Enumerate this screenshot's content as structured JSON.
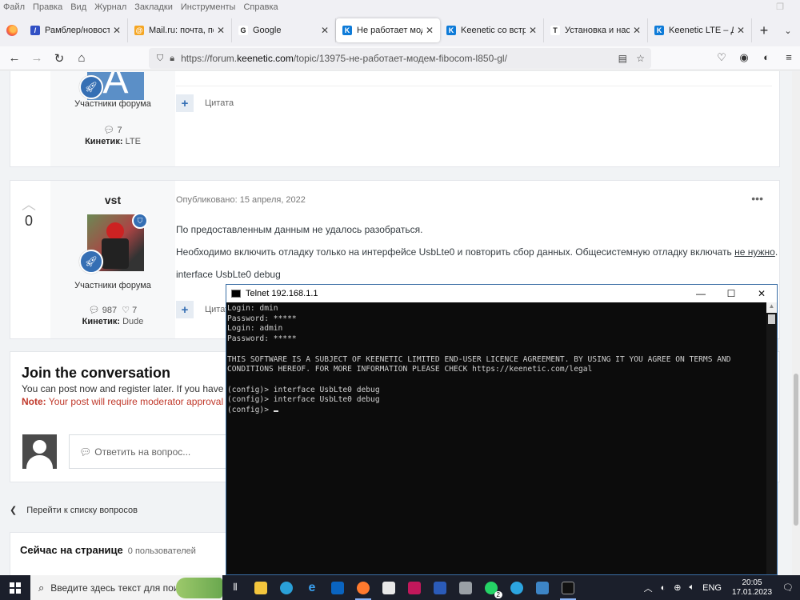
{
  "menu": [
    "Файл",
    "Правка",
    "Вид",
    "Журнал",
    "Закладки",
    "Инструменты",
    "Справка"
  ],
  "tabs": [
    {
      "title": "Рамблер/новости, почта",
      "color": "#3150c4",
      "glyph": "/"
    },
    {
      "title": "Mail.ru: почта, поиск",
      "color": "#f5a623",
      "glyph": "@"
    },
    {
      "title": "Google",
      "color": "#ffffff",
      "glyph": "G"
    },
    {
      "title": "Не работает модем Fibocom",
      "color": "#0e7bd8",
      "glyph": "K"
    },
    {
      "title": "Keenetic со встроенным",
      "color": "#0e7bd8",
      "glyph": "K"
    },
    {
      "title": "Установка и настройка",
      "color": "#ffffff",
      "glyph": "T"
    },
    {
      "title": "Keenetic LTE – Диагностика",
      "color": "#0e7bd8",
      "glyph": "K"
    }
  ],
  "url": {
    "prefix": "https://forum.",
    "domain": "keenetic.com",
    "path": "/topic/13975-не-работает-модем-fibocom-l850-gl/"
  },
  "post1": {
    "avatar_letter": "A",
    "role": "Участники форума",
    "posts": "7",
    "kinetic_label": "Кинетик:",
    "kinetic_value": "LTE",
    "quote": "Цитата"
  },
  "post2": {
    "author": "vst",
    "votes": "0",
    "role": "Участники форума",
    "posts": "987",
    "reputation": "7",
    "kinetic_label": "Кинетик:",
    "kinetic_value": "Dude",
    "published": "Опубликовано: 15 апреля, 2022",
    "p1": "По предоставленным данным не удалось разобраться.",
    "p2_start": "Необходимо включить отладку только на интерфейсе UsbLte0 и повторить сбор данных. Общесистемную отладку включать ",
    "p2_link": "не нужно",
    "p2_end": ".",
    "p3": "interface UsbLte0 debug",
    "quote": "Цитата"
  },
  "join": {
    "title": "Join the conversation",
    "sub": "You can post now and register later. If you have a",
    "note_label": "Note:",
    "note_text": " Your post will require moderator approval b",
    "reply_placeholder": "Ответить на вопрос..."
  },
  "back_link": "Перейти к списку вопросов",
  "online": {
    "title": "Сейчас на странице",
    "count": "0 пользователей"
  },
  "telnet": {
    "title": "Telnet 192.168.1.1",
    "lines": [
      "Login: dmin",
      "Password: *****",
      "Login: admin",
      "Password: *****",
      "",
      "THIS SOFTWARE IS A SUBJECT OF KEENETIC LIMITED END-USER LICENCE AGREEMENT. BY USING IT YOU AGREE ON TERMS AND",
      "CONDITIONS HEREOF. FOR MORE INFORMATION PLEASE CHECK https://keenetic.com/legal",
      "",
      "(config)> interface UsbLte0 debug",
      "(config)> interface UsbLte0 debug",
      "(config)> "
    ]
  },
  "taskbar": {
    "search_placeholder": "Введите здесь текст для поиска",
    "lang": "ENG",
    "time": "20:05",
    "date": "17.01.2023",
    "whatsapp_badge": "2"
  }
}
